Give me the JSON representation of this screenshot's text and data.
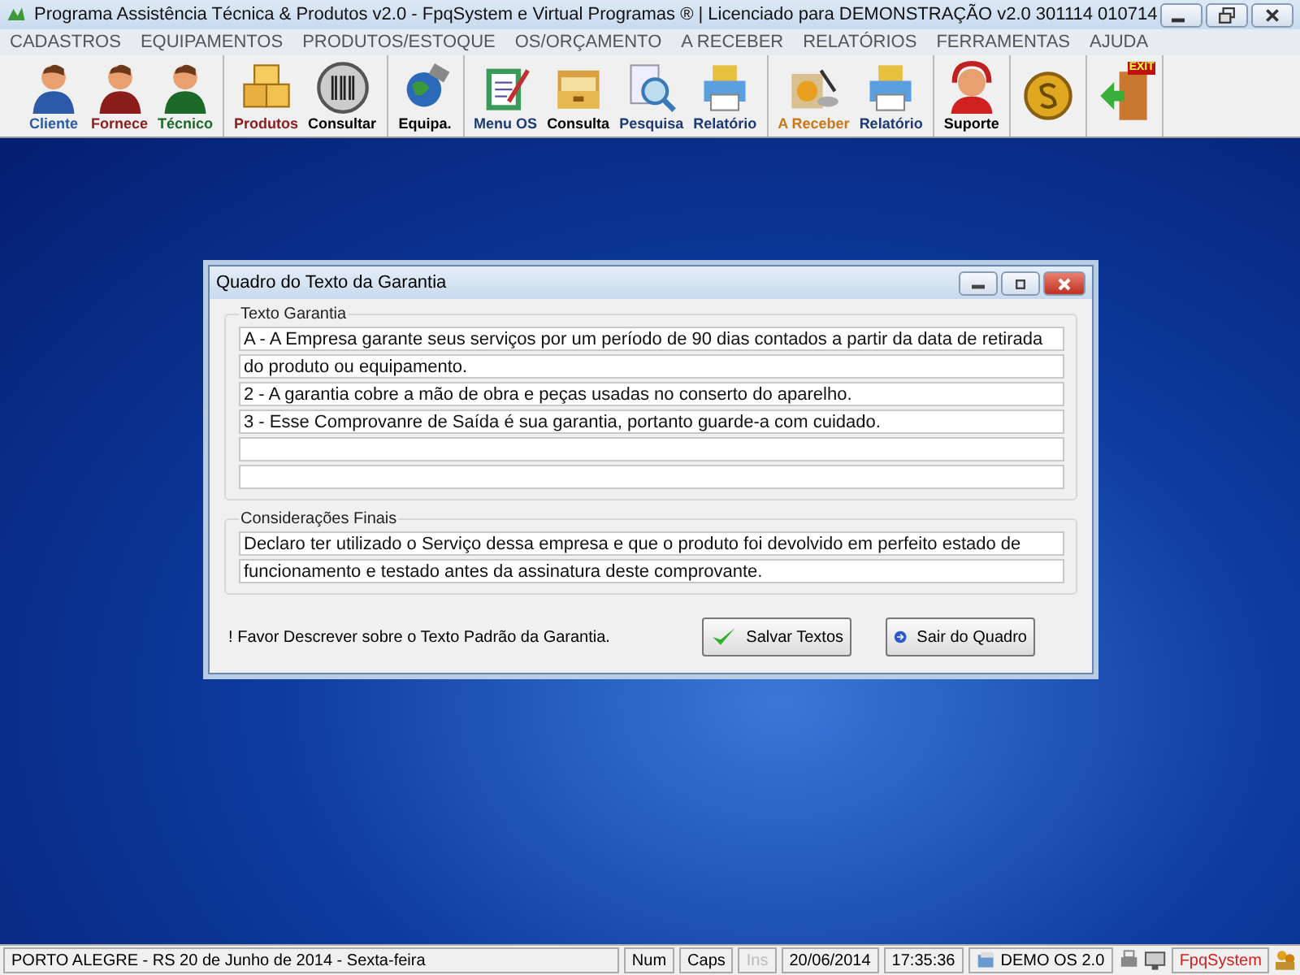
{
  "window": {
    "title": "Programa Assistência Técnica & Produtos v2.0 - FpqSystem e Virtual Programas ® | Licenciado para  DEMONSTRAÇÃO v2.0 301114 010714"
  },
  "menu": [
    "CADASTROS",
    "EQUIPAMENTOS",
    "PRODUTOS/ESTOQUE",
    "OS/ORÇAMENTO",
    "A RECEBER",
    "RELATÓRIOS",
    "FERRAMENTAS",
    "AJUDA"
  ],
  "toolbar": [
    {
      "group": [
        {
          "kind": "person",
          "label": "Cliente",
          "color": "#2a5aa8"
        },
        {
          "kind": "person",
          "label": "Fornece",
          "color": "#8a1c1c"
        },
        {
          "kind": "person",
          "label": "Técnico",
          "color": "#1c6a2a"
        }
      ]
    },
    {
      "group": [
        {
          "kind": "boxes",
          "label": "Produtos",
          "color": "#8a1c1c"
        },
        {
          "kind": "barcode",
          "label": "Consultar",
          "color": "#000000"
        }
      ]
    },
    {
      "group": [
        {
          "kind": "globe",
          "label": "Equipa.",
          "color": "#000000"
        }
      ]
    },
    {
      "group": [
        {
          "kind": "clipboard",
          "label": "Menu OS",
          "color": "#1c3a78"
        },
        {
          "kind": "folder",
          "label": "Consulta",
          "color": "#000000"
        },
        {
          "kind": "magnifier",
          "label": "Pesquisa",
          "color": "#1c3a78"
        },
        {
          "kind": "printer",
          "label": "Relatório",
          "color": "#1c3a78"
        }
      ]
    },
    {
      "group": [
        {
          "kind": "money",
          "label": "A Receber",
          "color": "#c87818"
        },
        {
          "kind": "printer",
          "label": "Relatório",
          "color": "#1c3a78"
        }
      ]
    },
    {
      "group": [
        {
          "kind": "headset",
          "label": "Suporte",
          "color": "#000000"
        }
      ]
    },
    {
      "group": [
        {
          "kind": "coin"
        }
      ]
    },
    {
      "group": [
        {
          "kind": "exit",
          "text": "EXIT"
        }
      ]
    }
  ],
  "dialog": {
    "title": "Quadro do Texto da Garantia",
    "warranty": {
      "legend": "Texto Garantia",
      "lines": [
        "A - A Empresa garante seus serviços por um período de 90 dias contados a partir da data de retirada",
        "do produto ou equipamento.",
        "2 - A garantia cobre a mão de obra e peças usadas no conserto do aparelho.",
        "3 - Esse Comprovanre de Saída é sua garantia, portanto guarde-a com cuidado."
      ]
    },
    "final": {
      "legend": "Considerações Finais",
      "lines": [
        "Declaro ter utilizado o Serviço dessa empresa e que o produto foi devolvido em perfeito estado de",
        "funcionamento e testado antes da assinatura deste comprovante."
      ]
    },
    "note": "! Favor Descrever sobre o Texto Padrão da Garantia.",
    "buttons": [
      {
        "kind": "save",
        "label": "Salvar Textos"
      },
      {
        "kind": "exit",
        "label": "Sair do Quadro"
      }
    ]
  },
  "status_bar": [
    {
      "text": "PORTO ALEGRE - RS 20 de Junho de 2014 - Sexta-feira",
      "disabled": false
    },
    {
      "text": "Num",
      "disabled": false
    },
    {
      "text": "Caps",
      "disabled": false
    },
    {
      "text": "Ins",
      "disabled": true
    },
    {
      "text": "20/06/2014",
      "disabled": false
    },
    {
      "text": "17:35:36",
      "disabled": false
    },
    {
      "text": "DEMO OS 2.0",
      "disabled": false,
      "icon": true
    },
    {
      "text": "FpqSystem",
      "disabled": false,
      "color": "#d02020"
    }
  ]
}
